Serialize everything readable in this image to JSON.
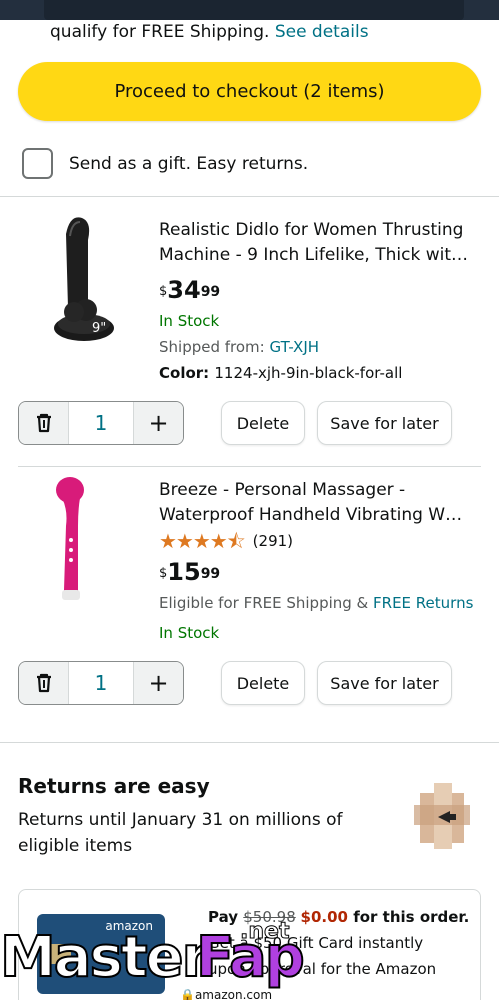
{
  "shipping": {
    "text": "qualify for FREE Shipping.",
    "link": "See details"
  },
  "checkout": {
    "label": "Proceed to checkout (2 items)"
  },
  "gift": {
    "label": "Send as a gift. Easy returns."
  },
  "cart": {
    "items": [
      {
        "title_line1": "Realistic Didlo for Women Thrusting",
        "title_line2": "Machine - 9 Inch Lifelike, Thick wit…",
        "price_symbol": "$",
        "price_whole": "34",
        "price_fraction": "99",
        "stock": "In Stock",
        "shipped_label": "Shipped from: ",
        "shipped_from": "GT-XJH",
        "color_label": "Color: ",
        "color_value": "1124-xjh-9in-black-for-all",
        "image_label": "9\"",
        "quantity": "1",
        "delete_label": "Delete",
        "save_label": "Save for later"
      },
      {
        "title_line1": "Breeze - Personal Massager -",
        "title_line2": "Waterproof Handheld Vibrating W…",
        "rating": 4.5,
        "rating_stars": "★★★★⯪",
        "rating_count": "(291)",
        "price_symbol": "$",
        "price_whole": "15",
        "price_fraction": "99",
        "shipping_text": "Eligible for FREE Shipping & ",
        "returns_link": "FREE Returns",
        "stock": "In Stock",
        "quantity": "1",
        "delete_label": "Delete",
        "save_label": "Save for later"
      }
    ]
  },
  "returns": {
    "title": "Returns are easy",
    "text": "Returns until January 31 on millions of eligible items"
  },
  "giftcard": {
    "brand": "amazon",
    "pay": "Pay ",
    "old_price": "$50.98",
    "new_price": "$0.00",
    "suffix": " for this order.",
    "line2": "Get a $50 Gift Card instantly",
    "line3": "upon approval for the Amazon"
  },
  "browser": {
    "url": "amazon.com"
  },
  "watermark": {
    "master": "Master",
    "fap": "Fap",
    "net": ".net"
  },
  "colors": {
    "checkout_yellow": "#ffd814",
    "link_teal": "#007185",
    "stock_green": "#007600",
    "star_orange": "#de7921",
    "price_red": "#b12704"
  }
}
